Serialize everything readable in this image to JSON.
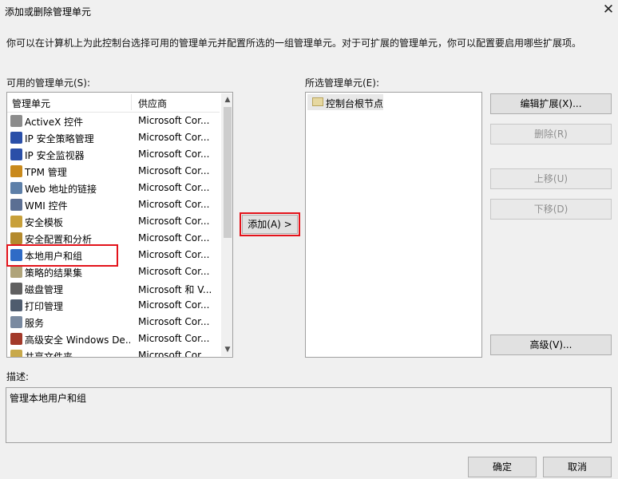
{
  "window": {
    "title": "添加或删除管理单元",
    "close_glyph": "✕"
  },
  "description": "你可以在计算机上为此控制台选择可用的管理单元并配置所选的一组管理单元。对于可扩展的管理单元，你可以配置要启用哪些扩展项。",
  "available": {
    "label": "可用的管理单元(S):",
    "columns": {
      "name": "管理单元",
      "vendor": "供应商"
    },
    "items": [
      {
        "name": "ActiveX 控件",
        "vendor": "Microsoft Cor...",
        "icon": "activex-control-icon",
        "color": "#8c8c8c"
      },
      {
        "name": "IP 安全策略管理",
        "vendor": "Microsoft Cor...",
        "icon": "ip-security-policy-icon",
        "color": "#2a4fa8"
      },
      {
        "name": "IP 安全监视器",
        "vendor": "Microsoft Cor...",
        "icon": "ip-security-monitor-icon",
        "color": "#2a4fa8"
      },
      {
        "name": "TPM 管理",
        "vendor": "Microsoft Cor...",
        "icon": "tpm-icon",
        "color": "#c98a1d"
      },
      {
        "name": "Web 地址的链接",
        "vendor": "Microsoft Cor...",
        "icon": "web-link-icon",
        "color": "#5d7fa8"
      },
      {
        "name": "WMI 控件",
        "vendor": "Microsoft Cor...",
        "icon": "wmi-control-icon",
        "color": "#5b6f93"
      },
      {
        "name": "安全模板",
        "vendor": "Microsoft Cor...",
        "icon": "security-template-icon",
        "color": "#c8a03a"
      },
      {
        "name": "安全配置和分析",
        "vendor": "Microsoft Cor...",
        "icon": "security-analysis-icon",
        "color": "#b48a2d"
      },
      {
        "name": "本地用户和组",
        "vendor": "Microsoft Cor...",
        "icon": "local-users-groups-icon",
        "color": "#2f6bc6"
      },
      {
        "name": "策略的结果集",
        "vendor": "Microsoft Cor...",
        "icon": "rsop-icon",
        "color": "#b0a47a"
      },
      {
        "name": "磁盘管理",
        "vendor": "Microsoft 和 V...",
        "icon": "disk-management-icon",
        "color": "#606060"
      },
      {
        "name": "打印管理",
        "vendor": "Microsoft Cor...",
        "icon": "print-management-icon",
        "color": "#4f5c6e"
      },
      {
        "name": "服务",
        "vendor": "Microsoft Cor...",
        "icon": "services-icon",
        "color": "#7a8aa0"
      },
      {
        "name": "高级安全 Windows De...",
        "vendor": "Microsoft Cor...",
        "icon": "firewall-icon",
        "color": "#a33a2a"
      },
      {
        "name": "共享文件夹",
        "vendor": "Microsoft Cor...",
        "icon": "shared-folder-icon",
        "color": "#c8a94b"
      }
    ]
  },
  "add_button": "添加(A) >",
  "selected": {
    "label": "所选管理单元(E):",
    "items": [
      {
        "name": "控制台根节点",
        "icon": "folder-icon"
      }
    ]
  },
  "right_buttons": {
    "edit_extensions": "编辑扩展(X)...",
    "remove": "删除(R)",
    "move_up": "上移(U)",
    "move_down": "下移(D)",
    "advanced": "高级(V)..."
  },
  "description_section": {
    "label": "描述:",
    "text": "管理本地用户和组"
  },
  "footer": {
    "ok": "确定",
    "cancel": "取消"
  },
  "colors": {
    "highlight_red": "#e3131b",
    "selection_bg": "#cce8ff"
  }
}
